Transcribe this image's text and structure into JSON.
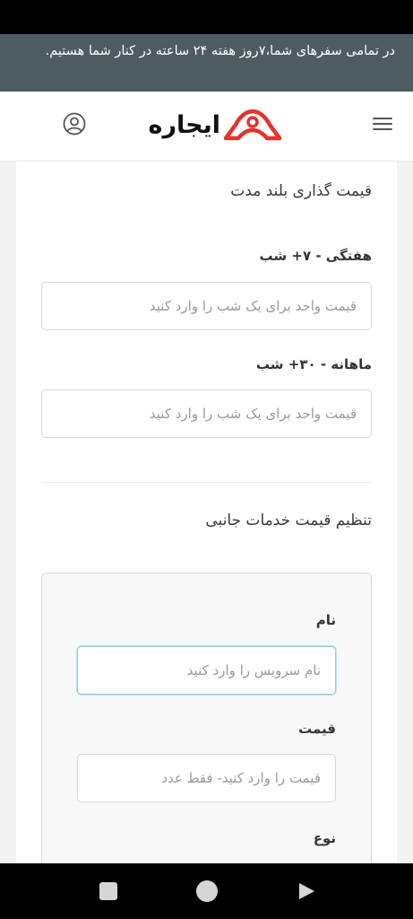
{
  "notice": {
    "text": "در تمامی سفرهای شما،۷روز هفته ۲۴ ساعته در کنار شما هستیم."
  },
  "header": {
    "logo_text": "ایجاره",
    "menu_icon": "hamburger-menu-icon",
    "user_icon": "user-account-icon",
    "brand_color": "#e5322d"
  },
  "long_term_pricing": {
    "title": "قیمت گذاری بلند مدت",
    "weekly": {
      "label": "هفتگی - ۷+ شب",
      "placeholder": "قیمت واحد برای یک شب را وارد کنید",
      "value": ""
    },
    "monthly": {
      "label": "ماهانه - ۳۰+ شب",
      "placeholder": "قیمت واحد برای یک شب را وارد کنید",
      "value": ""
    }
  },
  "side_services": {
    "title": "تنظیم قیمت خدمات جانبی",
    "name": {
      "label": "نام",
      "placeholder": "نام سرویس را وارد کنید",
      "value": ""
    },
    "price": {
      "label": "قیمت",
      "placeholder": "قیمت را وارد کنید- فقط عدد",
      "value": ""
    },
    "type": {
      "label": "نوع"
    }
  },
  "navigation": {
    "recents_icon": "square-recents-icon",
    "home_icon": "circle-home-icon",
    "back_icon": "triangle-back-icon"
  }
}
